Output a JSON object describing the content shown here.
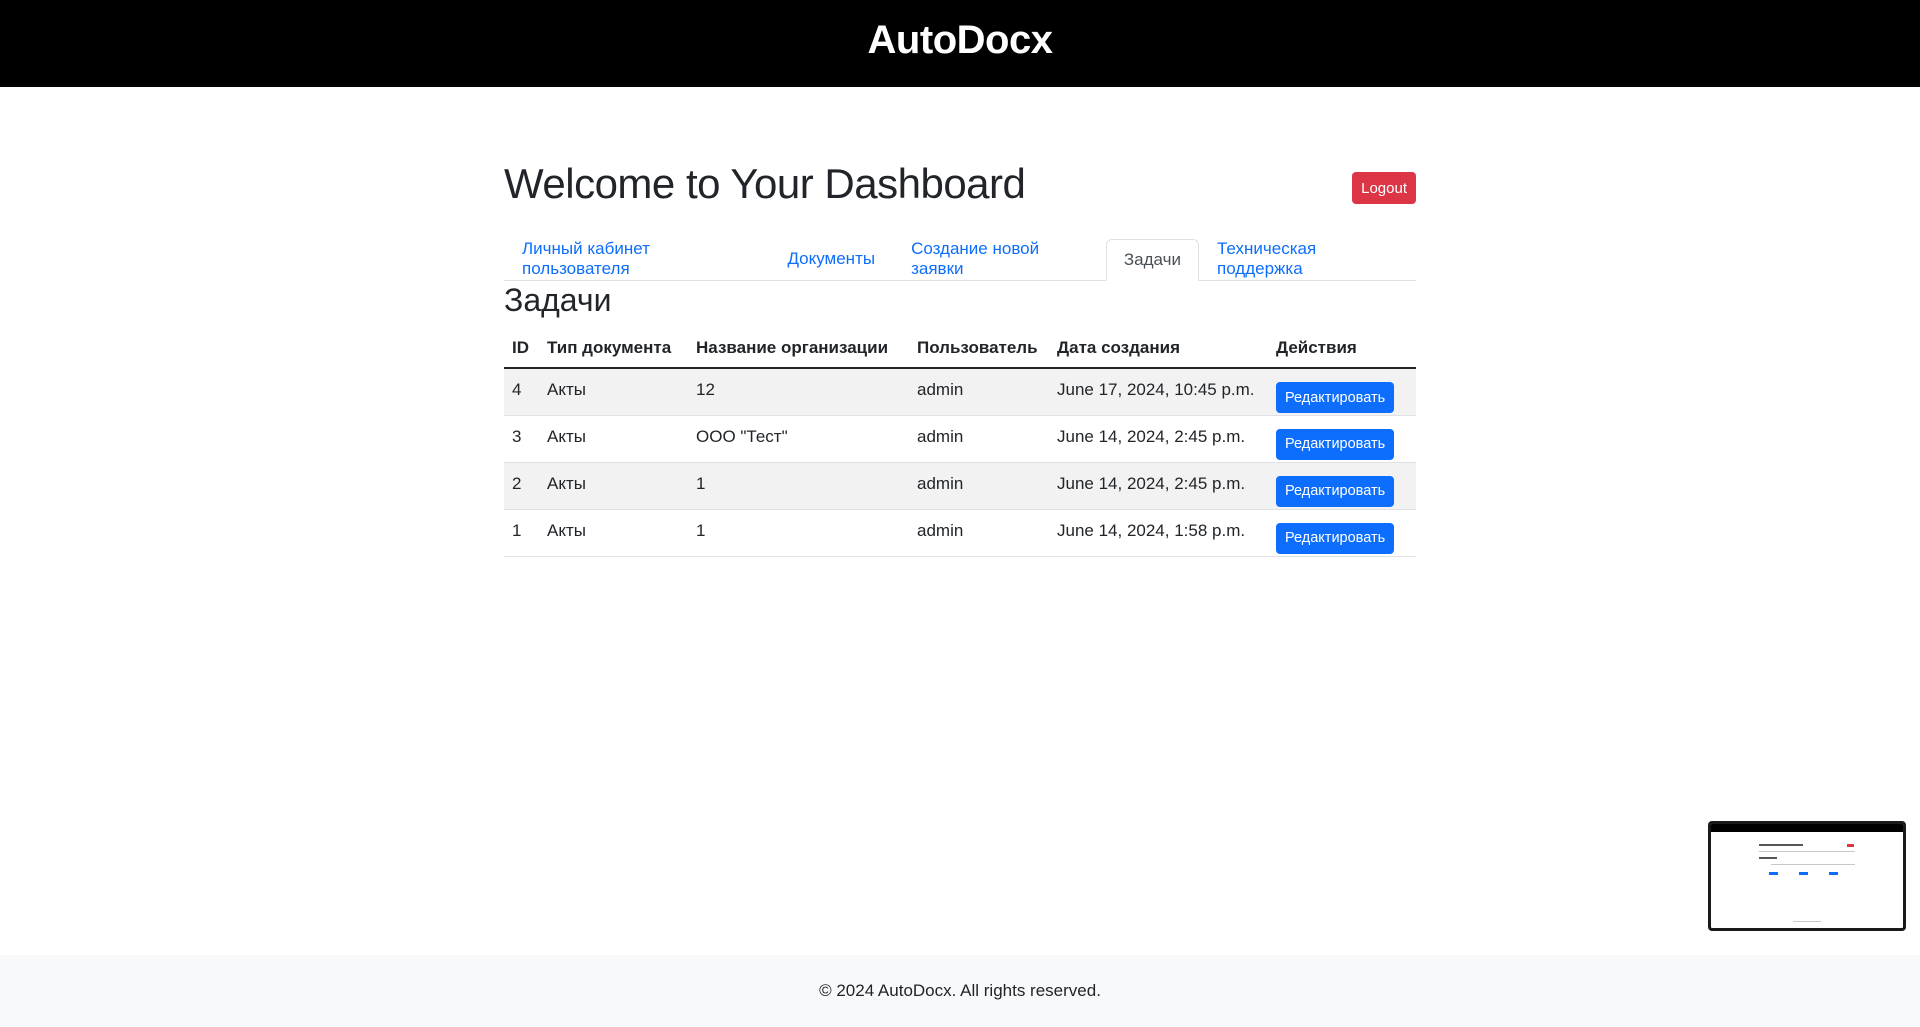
{
  "header": {
    "brand": "AutoDocx"
  },
  "page": {
    "title": "Welcome to Your Dashboard",
    "logout_label": "Logout"
  },
  "tabs": [
    {
      "label": "Личный кабинет пользователя",
      "active": false
    },
    {
      "label": "Документы",
      "active": false
    },
    {
      "label": "Создание новой заявки",
      "active": false
    },
    {
      "label": "Задачи",
      "active": true
    },
    {
      "label": "Техническая поддержка",
      "active": false
    }
  ],
  "section": {
    "title": "Задачи"
  },
  "table": {
    "columns": [
      "ID",
      "Тип документа",
      "Название организации",
      "Пользователь",
      "Дата создания",
      "Действия"
    ],
    "rows": [
      {
        "id": "4",
        "doc_type": "Акты",
        "org": "12",
        "user": "admin",
        "created": "June 17, 2024, 10:45 p.m.",
        "action": "Редактировать"
      },
      {
        "id": "3",
        "doc_type": "Акты",
        "org": "ООО \"Тест\"",
        "user": "admin",
        "created": "June 14, 2024, 2:45 p.m.",
        "action": "Редактировать"
      },
      {
        "id": "2",
        "doc_type": "Акты",
        "org": "1",
        "user": "admin",
        "created": "June 14, 2024, 2:45 p.m.",
        "action": "Редактировать"
      },
      {
        "id": "1",
        "doc_type": "Акты",
        "org": "1",
        "user": "admin",
        "created": "June 14, 2024, 1:58 p.m.",
        "action": "Редактировать"
      }
    ]
  },
  "footer": {
    "text": "© 2024 AutoDocx. All rights reserved."
  },
  "colors": {
    "header_bg": "#000000",
    "logout": "#dc3545",
    "primary": "#0d6efd",
    "footer_bg": "#f8f9fa"
  }
}
